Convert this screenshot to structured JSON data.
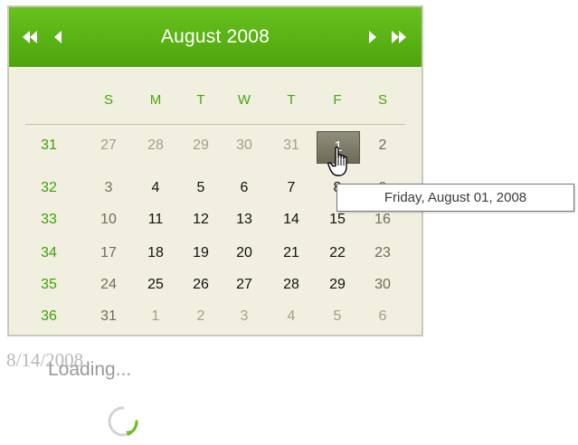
{
  "calendar": {
    "title": "August 2008",
    "nav": {
      "prev_year": "double-left-arrow-icon",
      "prev_month": "left-arrow-icon",
      "next_month": "right-arrow-icon",
      "next_year": "double-right-arrow-icon"
    },
    "day_headers": [
      "S",
      "M",
      "T",
      "W",
      "T",
      "F",
      "S"
    ],
    "weeks": [
      {
        "week": "31",
        "days": [
          "27",
          "28",
          "29",
          "30",
          "31",
          "1",
          "2"
        ]
      },
      {
        "week": "32",
        "days": [
          "3",
          "4",
          "5",
          "6",
          "7",
          "8",
          "9"
        ]
      },
      {
        "week": "33",
        "days": [
          "10",
          "11",
          "12",
          "13",
          "14",
          "15",
          "16"
        ]
      },
      {
        "week": "34",
        "days": [
          "17",
          "18",
          "19",
          "20",
          "21",
          "22",
          "23"
        ]
      },
      {
        "week": "35",
        "days": [
          "24",
          "25",
          "26",
          "27",
          "28",
          "29",
          "30"
        ]
      },
      {
        "week": "36",
        "days": [
          "31",
          "1",
          "2",
          "3",
          "4",
          "5",
          "6"
        ]
      }
    ],
    "selected_day": "1",
    "colors": {
      "header": "#56ad12",
      "accent": "#47a610",
      "background": "#f1efdf",
      "selected": "#7d7d69"
    }
  },
  "tooltip": {
    "text": "Friday, August 01, 2008"
  },
  "input": {
    "value": "8/14/2008"
  },
  "status": {
    "loading_text": "Loading..."
  }
}
